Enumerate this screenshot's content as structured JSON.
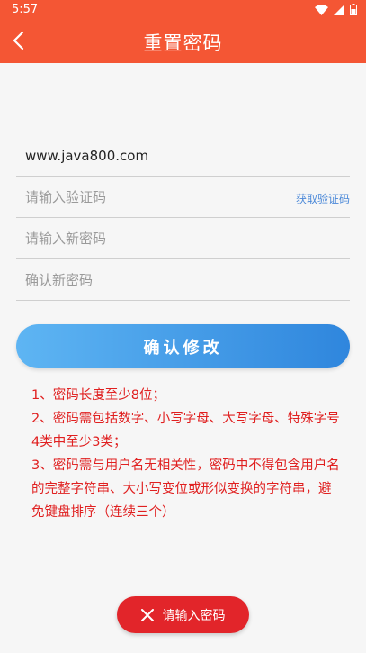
{
  "status_bar": {
    "time": "5:57"
  },
  "header": {
    "title": "重置密码",
    "back_icon": "chevron-left-icon"
  },
  "form": {
    "account": {
      "value": "www.java800.com",
      "placeholder": ""
    },
    "code": {
      "placeholder": "请输入验证码",
      "get_code_label": "获取验证码"
    },
    "new_password": {
      "placeholder": "请输入新密码"
    },
    "confirm_password": {
      "placeholder": "确认新密码"
    }
  },
  "confirm_button": {
    "label": "确认修改"
  },
  "rules": [
    "1、密码长度至少8位；",
    "2、密码需包括数字、小写字母、大写字母、特殊字号4类中至少3类；",
    "3、密码需与用户名无相关性，密码中不得包含用户名的完整字符串、大小写变位或形似变换的字符串，避免键盘排序（连续三个）"
  ],
  "toast": {
    "message": "请输入密码",
    "icon": "close-icon"
  },
  "colors": {
    "header": "#f45634",
    "button_start": "#5eb5f3",
    "button_end": "#2f86dd",
    "rule_text": "#e02020",
    "toast": "#e2252a",
    "link": "#4a88d8"
  }
}
